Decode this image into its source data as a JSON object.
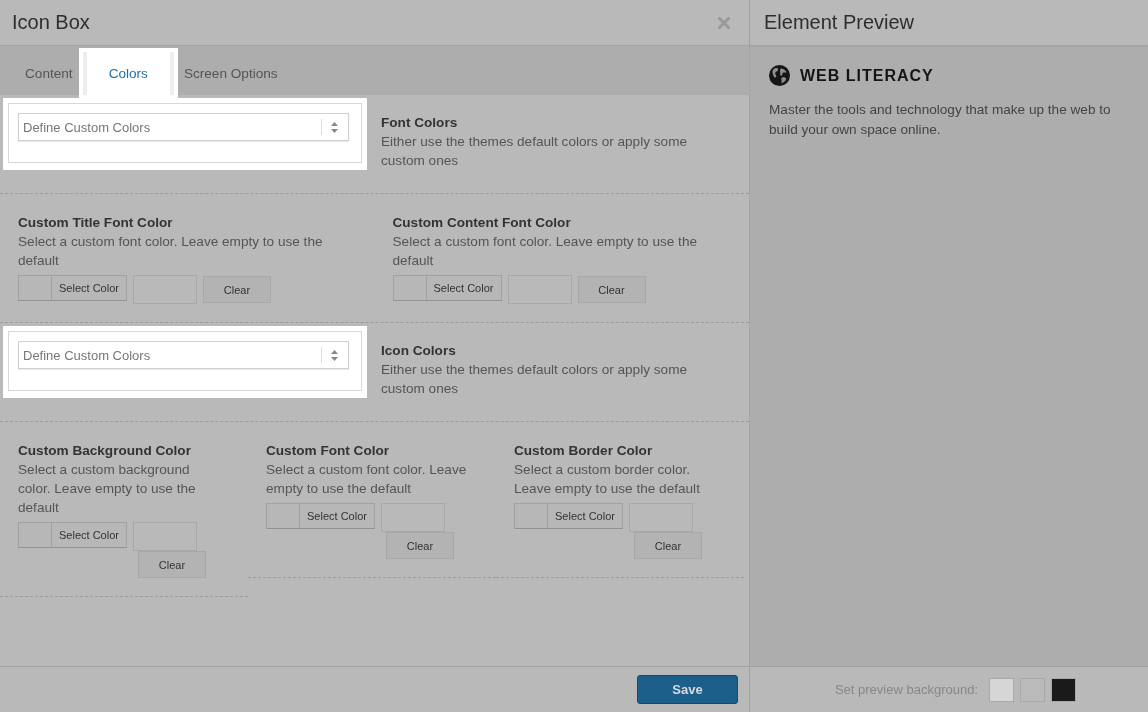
{
  "editor": {
    "title": "Icon Box",
    "tabs": [
      {
        "label": "Content",
        "selected": false,
        "highlighted": false
      },
      {
        "label": "Colors",
        "selected": true,
        "highlighted": true
      },
      {
        "label": "Screen Options",
        "selected": false,
        "highlighted": false
      }
    ],
    "sections": [
      {
        "kind": "select",
        "highlighted": true,
        "value": "Define Custom Colors",
        "title": "Font Colors",
        "description": "Either use the themes default colors or apply some custom ones"
      },
      {
        "kind": "color_fields",
        "fields": [
          {
            "title": "Custom Title Font Color",
            "description": "Select a custom font color. Leave empty to use the default",
            "select_button": "Select Color",
            "clear_button": "Clear"
          },
          {
            "title": "Custom Content Font Color",
            "description": "Select a custom font color. Leave empty to use the default",
            "select_button": "Select Color",
            "clear_button": "Clear"
          }
        ]
      },
      {
        "kind": "select",
        "highlighted": true,
        "value": "Define Custom Colors",
        "title": "Icon Colors",
        "description": "Either use the themes default colors or apply some custom ones"
      },
      {
        "kind": "color_fields",
        "fields": [
          {
            "title": "Custom Background Color",
            "description": "Select a custom background color. Leave empty to use the default",
            "select_button": "Select Color",
            "clear_button": "Clear"
          },
          {
            "title": "Custom Font Color",
            "description": "Select a custom font color. Leave empty to use the default",
            "select_button": "Select Color",
            "clear_button": "Clear"
          },
          {
            "title": "Custom Border Color",
            "description": "Select a custom border color. Leave empty to use the default",
            "select_button": "Select Color",
            "clear_button": "Clear"
          }
        ]
      }
    ],
    "save_button": "Save"
  },
  "preview": {
    "title": "Element Preview",
    "heading": "WEB LITERACY",
    "text": "Master the tools and technology that make up the web to build your own space online.",
    "background_label": "Set preview background:",
    "background_swatches": [
      {
        "color": "#d6d6d6"
      },
      {
        "color": "#bababa"
      },
      {
        "color": "#1a1a1a"
      }
    ]
  }
}
